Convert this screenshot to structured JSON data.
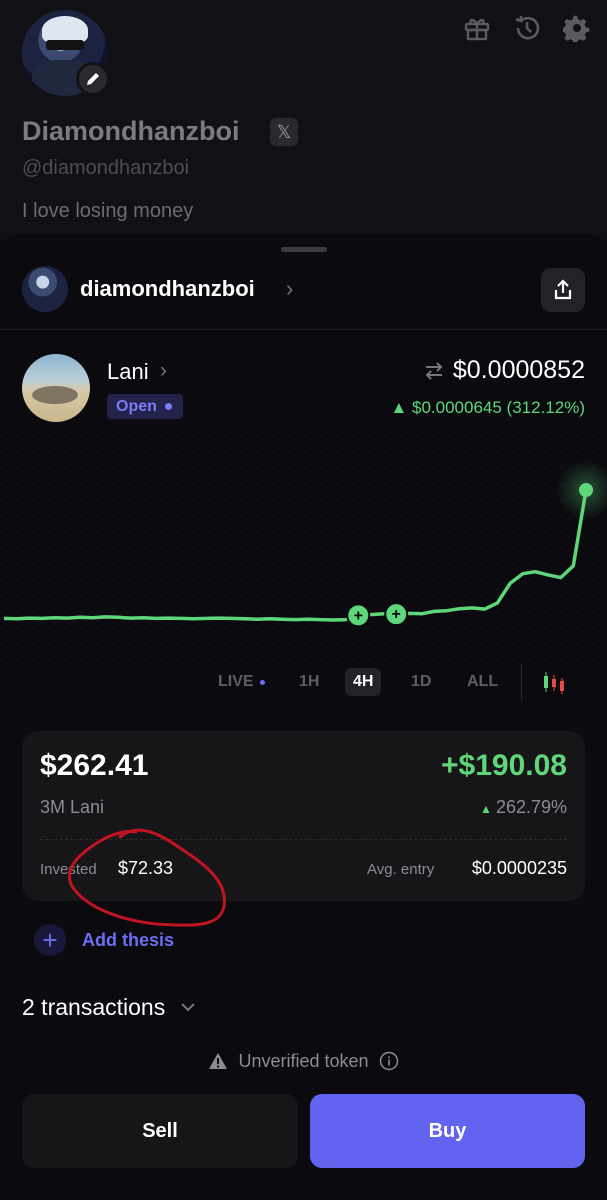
{
  "profile": {
    "display_name": "Diamondhanzboi",
    "x_badge": "𝕏",
    "handle": "@diamondhanzboi",
    "bio": "I love losing money",
    "icons": [
      "gift-icon",
      "history-icon",
      "gear-icon",
      "pencil-icon"
    ]
  },
  "sheet": {
    "username": "diamondhanzboi"
  },
  "token": {
    "name": "Lani",
    "status": "Open",
    "price": "$0.0000852",
    "change": "▲ $0.0000645 (312.12%)"
  },
  "timeframes": {
    "items": [
      "LIVE",
      "1H",
      "4H",
      "1D",
      "ALL"
    ],
    "active": "4H"
  },
  "position": {
    "value": "$262.41",
    "pnl": "+$190.08",
    "quantity": "3M Lani",
    "pnl_pct": "262.79%",
    "invested_label": "Invested",
    "invested_value": "$72.33",
    "avg_entry_label": "Avg. entry",
    "avg_entry_value": "$0.0000235"
  },
  "actions": {
    "add_thesis": "Add thesis",
    "transactions": "2 transactions",
    "unverified": "Unverified token",
    "sell": "Sell",
    "buy": "Buy"
  },
  "colors": {
    "accent": "#6264f0",
    "positive": "#5fd67a",
    "background": "#0a0a0f",
    "annotation": "#c01521"
  },
  "chart_data": {
    "type": "line",
    "series": [
      {
        "values": [
          100,
          99,
          101,
          100,
          102,
          101,
          103,
          102,
          104,
          103,
          101,
          102,
          100,
          101,
          100,
          99,
          100,
          101,
          100,
          99,
          98,
          99,
          98,
          97,
          98,
          97,
          96,
          97,
          108,
          110,
          112,
          111,
          113,
          112,
          118,
          120,
          125,
          127,
          124,
          140,
          190,
          215,
          220,
          212,
          205,
          235,
          430
        ]
      }
    ],
    "markers": [
      {
        "index": 28,
        "label": "+"
      },
      {
        "index": 31,
        "label": "+"
      }
    ]
  }
}
